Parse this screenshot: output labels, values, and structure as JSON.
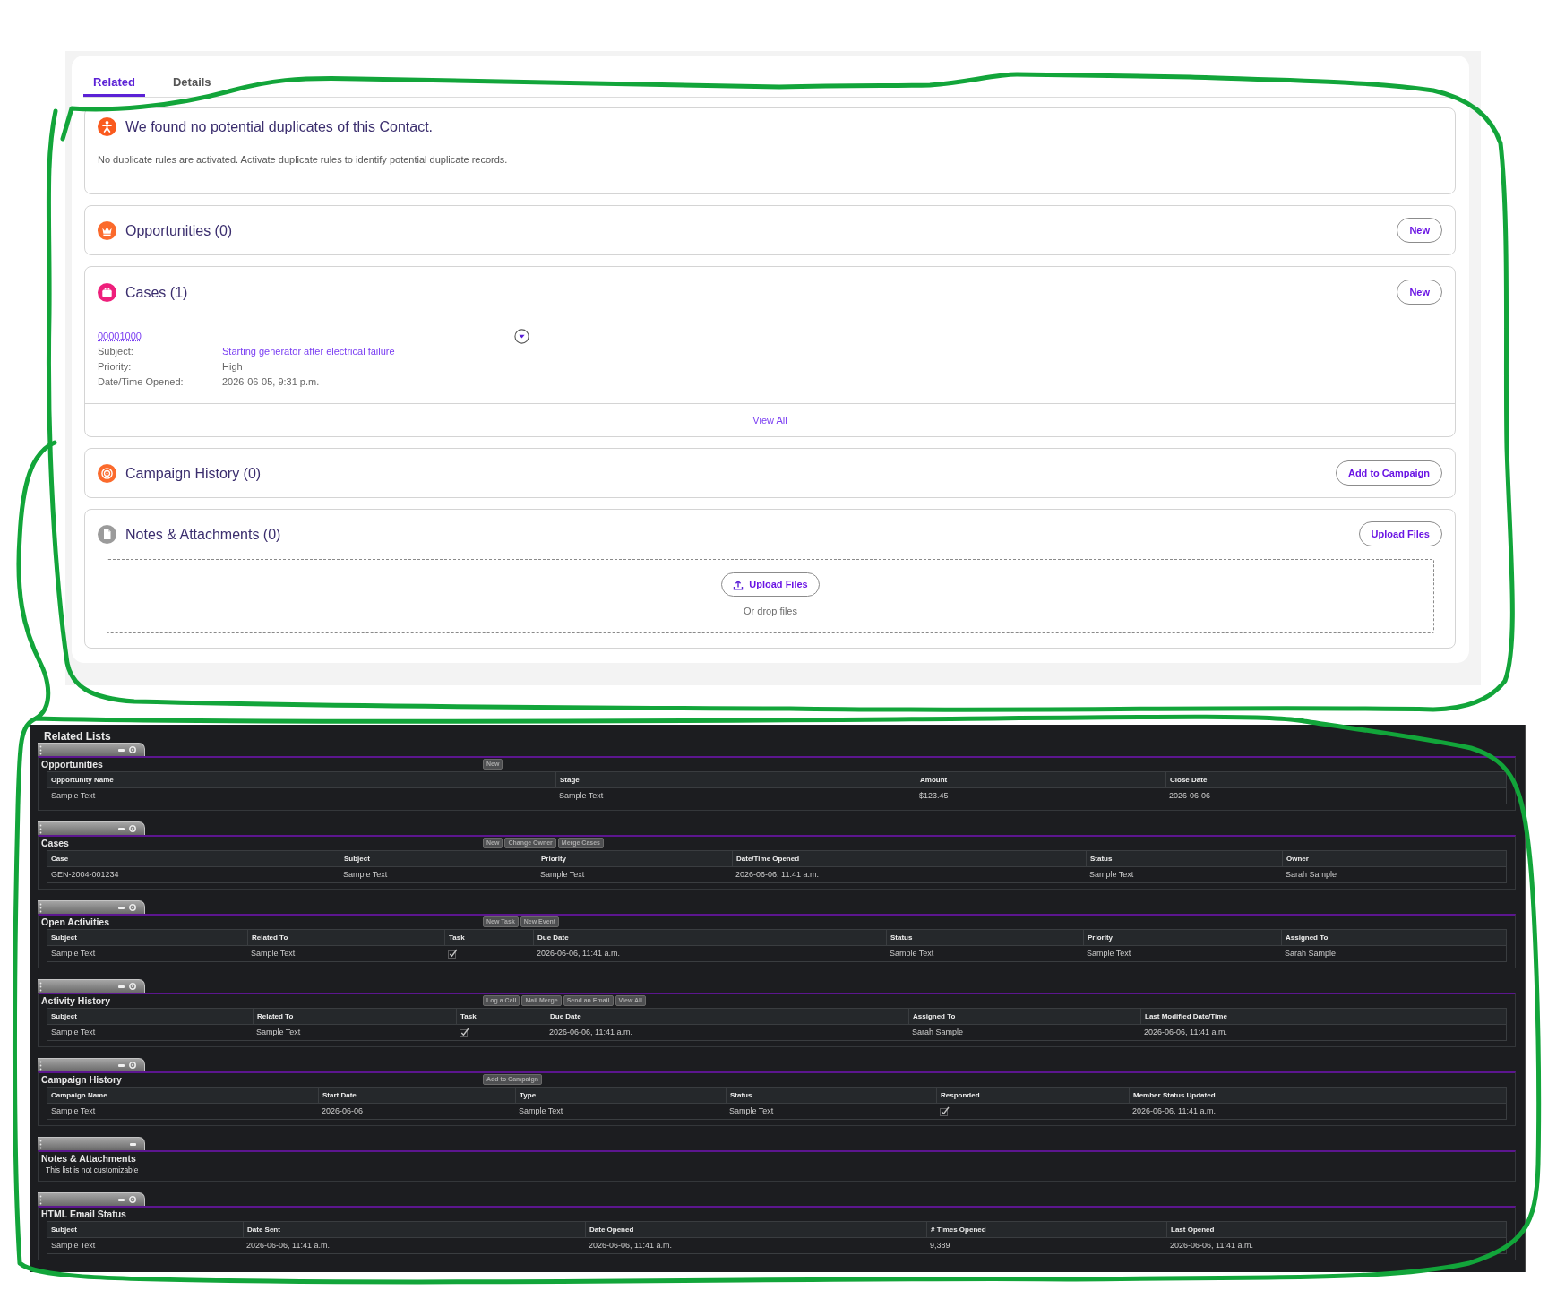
{
  "record_tabs": [
    {
      "label": "Related",
      "selected": true
    },
    {
      "label": "Details",
      "selected": false
    }
  ],
  "duplicates": {
    "title": "We found no potential duplicates of this Contact.",
    "message": "No duplicate rules are activated. Activate duplicate rules to identify potential duplicate records."
  },
  "related_cards": [
    {
      "kind": "opportunities",
      "title": "Opportunities (0)",
      "action": "New"
    },
    {
      "kind": "cases",
      "title": "Cases (1)",
      "action": "New",
      "records": [
        {
          "number": "00001000",
          "fields": [
            {
              "label": "Subject:",
              "value": "Starting generator after electrical failure",
              "link": true
            },
            {
              "label": "Priority:",
              "value": "High",
              "link": false
            },
            {
              "label": "Date/Time Opened:",
              "value": "2026-06-05, 9:31 p.m.",
              "link": false
            }
          ]
        }
      ],
      "footer_link": "View All"
    },
    {
      "kind": "campaigns",
      "title": "Campaign History (0)",
      "action": "Add to Campaign"
    },
    {
      "kind": "notes",
      "title": "Notes & Attachments (0)",
      "action": "Upload Files",
      "dropzone": {
        "button": "Upload Files",
        "hint": "Or drop files"
      }
    }
  ],
  "related_lists": {
    "heading": "Related Lists",
    "sections": [
      {
        "title": "Opportunities",
        "customize_icon": true,
        "buttons": [
          "New"
        ],
        "columns": [
          "Opportunity Name",
          "Stage",
          "Amount",
          "Close Date"
        ],
        "rows": [
          [
            "Sample Text",
            "Sample Text",
            "$123.45",
            "2026-06-06"
          ]
        ]
      },
      {
        "title": "Cases",
        "customize_icon": true,
        "buttons": [
          "New",
          "Change Owner",
          "Merge Cases"
        ],
        "columns": [
          "Case",
          "Subject",
          "Priority",
          "Date/Time Opened",
          "Status",
          "Owner"
        ],
        "rows": [
          [
            "GEN-2004-001234",
            "Sample Text",
            "Sample Text",
            "2026-06-06, 11:41 a.m.",
            "Sample Text",
            "Sarah Sample"
          ]
        ]
      },
      {
        "title": "Open Activities",
        "customize_icon": true,
        "buttons": [
          "New Task",
          "New Event"
        ],
        "columns": [
          "Subject",
          "Related To",
          "Task",
          "Due Date",
          "Status",
          "Priority",
          "Assigned To"
        ],
        "rows": [
          [
            "Sample Text",
            "Sample Text",
            {
              "kind": "checkbox",
              "checked": true
            },
            "2026-06-06, 11:41 a.m.",
            "Sample Text",
            "Sample Text",
            "Sarah Sample"
          ]
        ]
      },
      {
        "title": "Activity History",
        "customize_icon": true,
        "buttons": [
          "Log a Call",
          "Mail Merge",
          "Send an Email",
          "View All"
        ],
        "columns": [
          "Subject",
          "Related To",
          "Task",
          "Due Date",
          "Assigned To",
          "Last Modified Date/Time"
        ],
        "rows": [
          [
            "Sample Text",
            "Sample Text",
            {
              "kind": "checkbox",
              "checked": true
            },
            "2026-06-06, 11:41 a.m.",
            "Sarah Sample",
            "2026-06-06, 11:41 a.m."
          ]
        ]
      },
      {
        "title": "Campaign History",
        "customize_icon": true,
        "buttons": [
          "Add to Campaign"
        ],
        "columns": [
          "Campaign Name",
          "Start Date",
          "Type",
          "Status",
          "Responded",
          "Member Status Updated"
        ],
        "rows": [
          [
            "Sample Text",
            "2026-06-06",
            "Sample Text",
            "Sample Text",
            {
              "kind": "checkbox",
              "checked": true
            },
            "2026-06-06, 11:41 a.m."
          ]
        ]
      },
      {
        "title": "Notes & Attachments",
        "customize_icon": false,
        "note": "This list is not customizable"
      },
      {
        "title": "HTML Email Status",
        "customize_icon": true,
        "columns": [
          "Subject",
          "Date Sent",
          "Date Opened",
          "# Times Opened",
          "Last Opened"
        ],
        "rows": [
          [
            "Sample Text",
            "2026-06-06, 11:41 a.m.",
            "2026-06-06, 11:41 a.m.",
            "9,389",
            "2026-06-06, 11:41 a.m."
          ]
        ]
      }
    ]
  }
}
